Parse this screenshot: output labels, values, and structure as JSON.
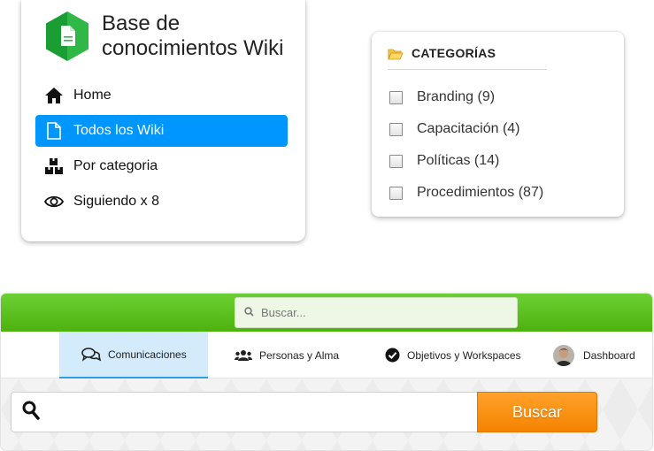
{
  "wiki": {
    "title": "Base de conocimientos Wiki",
    "logo_icon": "file-hexagon-icon",
    "brand_color": "#3bb54a",
    "nav": [
      {
        "label": "Home",
        "icon": "home-icon",
        "active": false
      },
      {
        "label": "Todos los Wiki",
        "icon": "document-icon",
        "active": true
      },
      {
        "label": "Por categoria",
        "icon": "boxes-icon",
        "active": false
      },
      {
        "label": "Siguiendo x 8",
        "icon": "eye-icon",
        "active": false
      }
    ],
    "active_color": "#0096ff"
  },
  "categories": {
    "header": "CATEGORÍAS",
    "header_icon": "folder-open-icon",
    "items": [
      {
        "label": "Branding (9)",
        "checked": false
      },
      {
        "label": "Capacitación (4)",
        "checked": false
      },
      {
        "label": "Políticas (14)",
        "checked": false
      },
      {
        "label": "Procedimientos (87)",
        "checked": false
      }
    ]
  },
  "app": {
    "top_search": {
      "placeholder": "Buscar..."
    },
    "topbar_color": "#55b91a",
    "tabs": [
      {
        "label": "Comunicaciones",
        "icon": "chat-bubbles-icon",
        "active": true
      },
      {
        "label": "Personas y Alma",
        "icon": "users-icon",
        "active": false
      },
      {
        "label": "Objetivos y Workspaces",
        "icon": "check-circle-icon",
        "active": false
      },
      {
        "label": "Dashboard",
        "icon": "avatar",
        "active": false
      }
    ],
    "search": {
      "value": "",
      "button_label": "Buscar",
      "button_color": "#f58300"
    }
  }
}
